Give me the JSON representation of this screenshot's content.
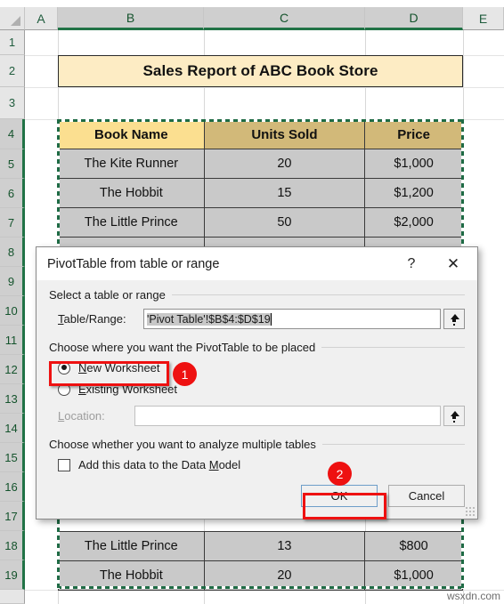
{
  "spreadsheet": {
    "column_headers": [
      "A",
      "B",
      "C",
      "D",
      "E"
    ],
    "selected_columns": [
      "B",
      "C",
      "D"
    ],
    "row_headers": [
      "1",
      "2",
      "3",
      "4",
      "5",
      "6",
      "7",
      "8",
      "9",
      "10",
      "11",
      "12",
      "13",
      "14",
      "15",
      "16",
      "17",
      "18",
      "19"
    ],
    "selected_rows": [
      "4",
      "5",
      "6",
      "7",
      "8",
      "9",
      "10",
      "11",
      "12",
      "13",
      "14",
      "15",
      "16",
      "17",
      "18",
      "19"
    ],
    "banner_title": "Sales Report of ABC Book Store",
    "table": {
      "headers": [
        "Book Name",
        "Units Sold",
        "Price"
      ],
      "rows": [
        [
          "The Kite Runner",
          "20",
          "$1,000"
        ],
        [
          "The Hobbit",
          "15",
          "$1,200"
        ],
        [
          "The Little Prince",
          "50",
          "$2,000"
        ],
        [
          "The Little Prince",
          "13",
          "$800"
        ],
        [
          "The Hobbit",
          "20",
          "$1,000"
        ]
      ]
    }
  },
  "dialog": {
    "title": "PivotTable from table or range",
    "help_icon": "?",
    "close_icon": "✕",
    "section1_label": "Select a table or range",
    "table_range_label": "Table/Range:",
    "table_range_value": "'Pivot Table'!$B$4:$D$19",
    "section2_label": "Choose where you want the PivotTable to be placed",
    "radio_new_worksheet": "New Worksheet",
    "radio_existing_worksheet": "Existing Worksheet",
    "selected_placement": "New Worksheet",
    "location_label": "Location:",
    "location_value": "",
    "section3_label": "Choose whether you want to analyze multiple tables",
    "checkbox_data_model": "Add this data to the Data Model",
    "checkbox_data_model_checked": false,
    "ok_label": "OK",
    "cancel_label": "Cancel",
    "range_picker_icon": "range-picker-icon"
  },
  "annotations": {
    "badge1": "1",
    "badge2": "2",
    "accent_color": "#ee1111"
  },
  "watermark": "wsxdn.com"
}
